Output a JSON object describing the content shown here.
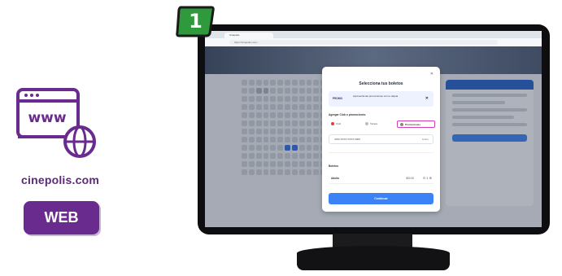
{
  "brand": {
    "site": "cinepolis.com",
    "platform_badge": "WEB",
    "colors": {
      "purple": "#6a2b8e",
      "green": "#2e9a3c",
      "accent_blue": "#3b82f6",
      "highlight_pink": "#d43fb8"
    },
    "icons": [
      "browser-window-icon",
      "globe-icon"
    ]
  },
  "step": {
    "number": "1"
  },
  "browser": {
    "tab_title": "Cinépolis",
    "url": "https://cinepolis.com/..."
  },
  "modal": {
    "close": "✕",
    "title": "Selecciona tus boletos",
    "promo": {
      "tag": "PROMO",
      "text": "Aprovecha las promociones con tu tarjeta",
      "close": "✕"
    },
    "payment_label": "Agregar Club o promociones",
    "payment_options": [
      "Club",
      "Tarjeta",
      "Promociones"
    ],
    "highlighted_option": "Promociones",
    "card_field": {
      "value": "4152 XXXX XXXX 0000",
      "action": "Editar"
    },
    "tickets_label": "Boletos",
    "ticket_row": {
      "label": "Adulto",
      "price": "$00.00",
      "quantity": "1"
    },
    "continue_label": "Continuar"
  }
}
